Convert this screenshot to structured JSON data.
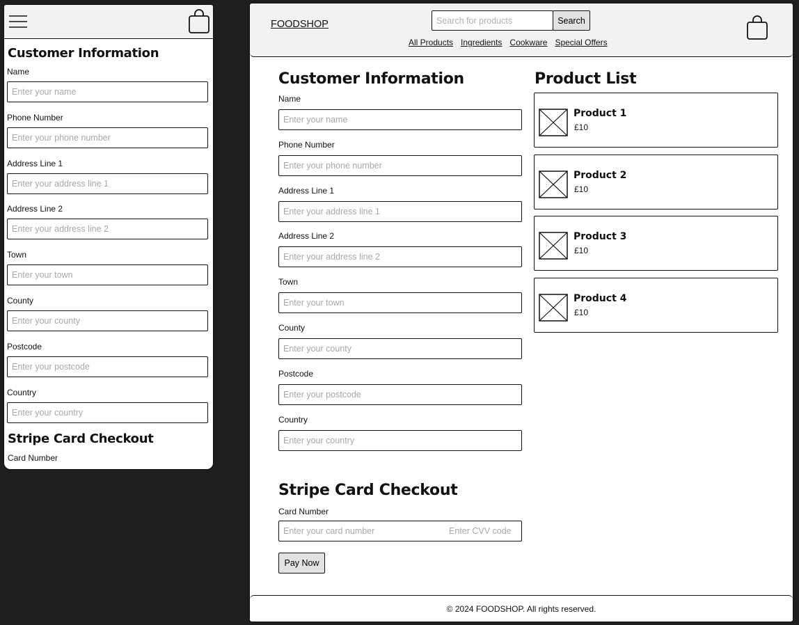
{
  "mobile": {
    "menu_icon": "hamburger-menu-icon",
    "cart_icon": "shopping-bag-icon",
    "customer_title": "Customer Information",
    "fields": [
      {
        "label": "Name",
        "placeholder": "Enter your name"
      },
      {
        "label": "Phone Number",
        "placeholder": "Enter your phone number"
      },
      {
        "label": "Address Line 1",
        "placeholder": "Enter your address line 1"
      },
      {
        "label": "Address Line 2",
        "placeholder": "Enter your address line 2"
      },
      {
        "label": "Town",
        "placeholder": "Enter your town"
      },
      {
        "label": "County",
        "placeholder": "Enter your county"
      },
      {
        "label": "Postcode",
        "placeholder": "Enter your postcode"
      },
      {
        "label": "Country",
        "placeholder": "Enter your country"
      }
    ],
    "stripe_title": "Stripe Card Checkout",
    "card_label": "Card Number"
  },
  "desktop": {
    "header": {
      "logo": "FOODSHOP",
      "search_placeholder": "Search for products",
      "search_button": "Search",
      "nav": [
        "All Products",
        "Ingredients",
        "Cookware",
        "Special Offers"
      ],
      "cart_icon": "shopping-bag-icon"
    },
    "customer_title": "Customer Information",
    "fields": [
      {
        "label": "Name",
        "placeholder": "Enter your name"
      },
      {
        "label": "Phone Number",
        "placeholder": "Enter your phone number"
      },
      {
        "label": "Address Line 1",
        "placeholder": "Enter your address line 1"
      },
      {
        "label": "Address Line 2",
        "placeholder": "Enter your address line 2"
      },
      {
        "label": "Town",
        "placeholder": "Enter your town"
      },
      {
        "label": "County",
        "placeholder": "Enter your county"
      },
      {
        "label": "Postcode",
        "placeholder": "Enter your postcode"
      },
      {
        "label": "Country",
        "placeholder": "Enter your country"
      }
    ],
    "stripe_title": "Stripe Card Checkout",
    "card_label": "Card Number",
    "card_placeholder": "Enter your card number",
    "cvv_placeholder": "Enter CVV code",
    "pay_button": "Pay Now",
    "product_list_title": "Product List",
    "products": [
      {
        "name": "Product 1",
        "price": "£10",
        "image_icon": "image-placeholder-icon"
      },
      {
        "name": "Product 2",
        "price": "£10",
        "image_icon": "image-placeholder-icon"
      },
      {
        "name": "Product 3",
        "price": "£10",
        "image_icon": "image-placeholder-icon"
      },
      {
        "name": "Product 4",
        "price": "£10",
        "image_icon": "image-placeholder-icon"
      }
    ],
    "footer": "© 2024 FOODSHOP. All rights reserved."
  }
}
